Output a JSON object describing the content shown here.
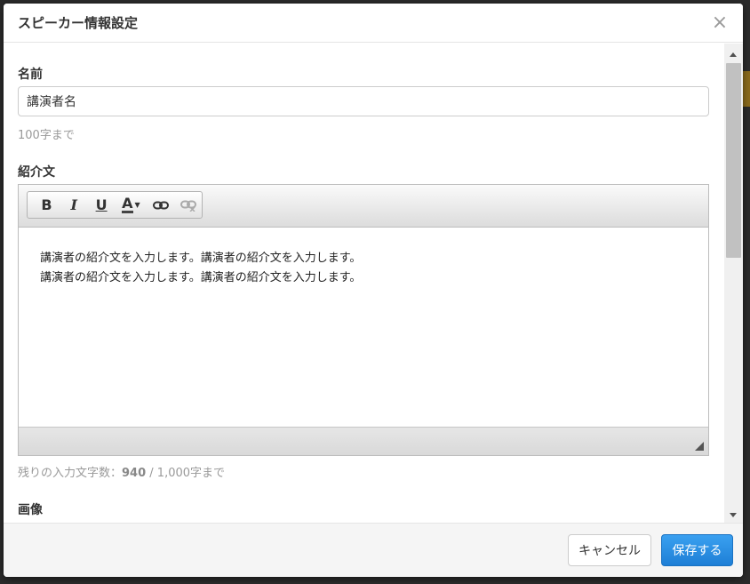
{
  "modal": {
    "title": "スピーカー情報設定",
    "close_symbol": "×"
  },
  "name_field": {
    "label": "名前",
    "value": "講演者名",
    "help": "100字まで"
  },
  "intro_field": {
    "label": "紹介文",
    "toolbar": {
      "bold": "B",
      "italic": "I",
      "underline": "U",
      "font_color": "A",
      "link_icon": "link-icon",
      "unlink_icon": "unlink-icon"
    },
    "content_lines": [
      "講演者の紹介文を入力します。講演者の紹介文を入力します。",
      "講演者の紹介文を入力します。講演者の紹介文を入力します。"
    ],
    "counter_prefix": "残りの入力文字数：",
    "counter_remaining": "940",
    "counter_suffix": "/ 1,000字まで"
  },
  "image_field": {
    "label": "画像"
  },
  "footer": {
    "cancel_label": "キャンセル",
    "save_label": "保存する"
  },
  "colors": {
    "primary": "#1e7fd6",
    "muted_text": "#999999"
  }
}
